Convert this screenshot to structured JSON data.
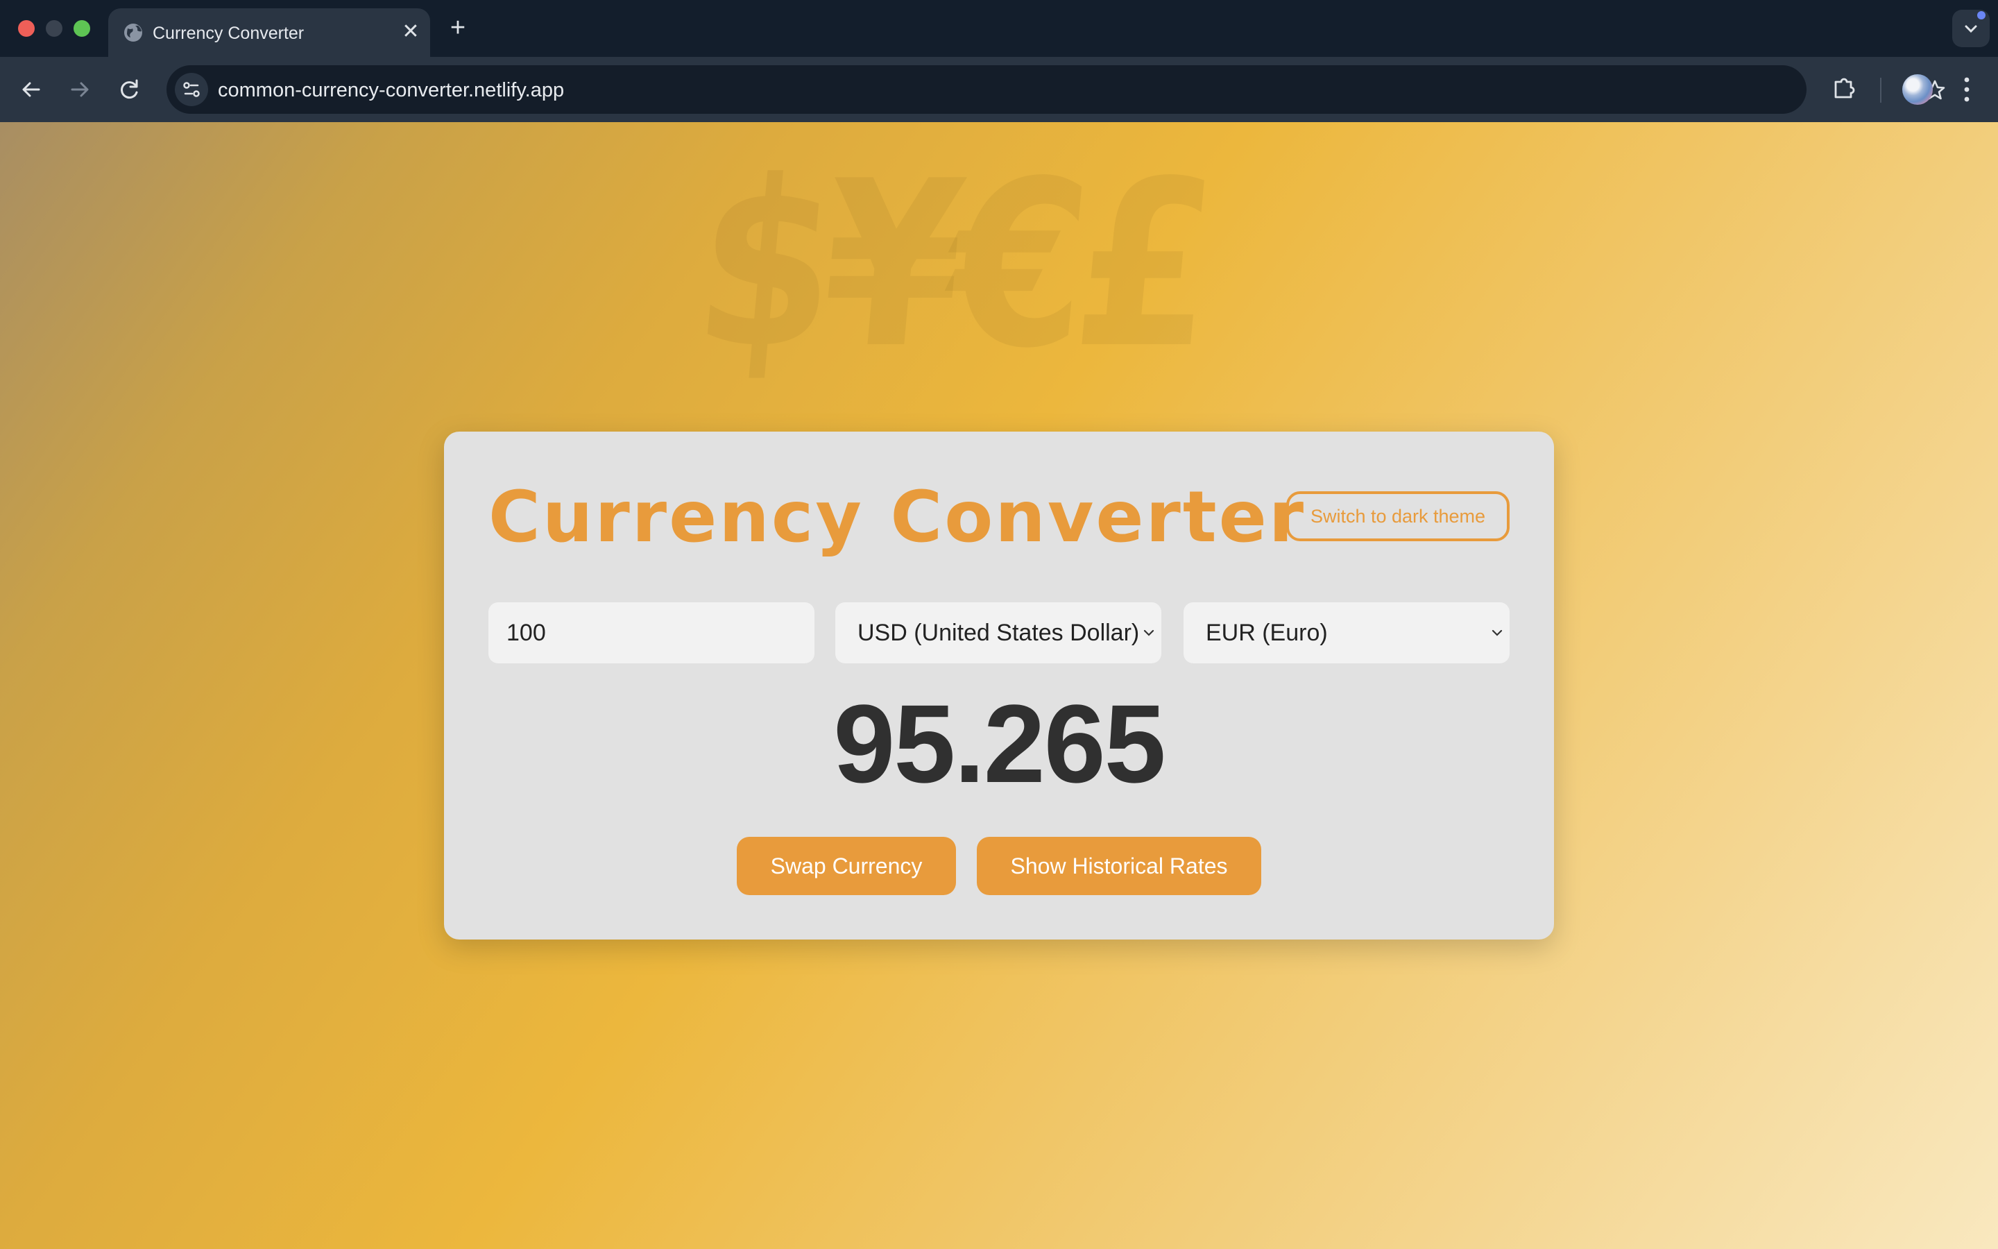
{
  "browser": {
    "tab_title": "Currency Converter",
    "url": "common-currency-converter.netlify.app"
  },
  "page": {
    "background_symbols": "$¥€£",
    "title": "Currency Converter",
    "theme_toggle_label": "Switch to dark theme",
    "amount_value": "100",
    "from_currency": "USD (United States Dollar)",
    "to_currency": "EUR (Euro)",
    "result": "95.265",
    "swap_label": "Swap Currency",
    "history_label": "Show Historical Rates"
  },
  "colors": {
    "accent": "#e89b3c",
    "card": "#e1e1e1",
    "result_text": "#303030"
  },
  "icons": {
    "back": "arrow-left-icon",
    "forward": "arrow-right-icon",
    "reload": "reload-icon",
    "site_info": "tune-icon",
    "bookmark": "star-icon",
    "extensions": "puzzle-icon",
    "menu": "kebab-menu-icon"
  }
}
